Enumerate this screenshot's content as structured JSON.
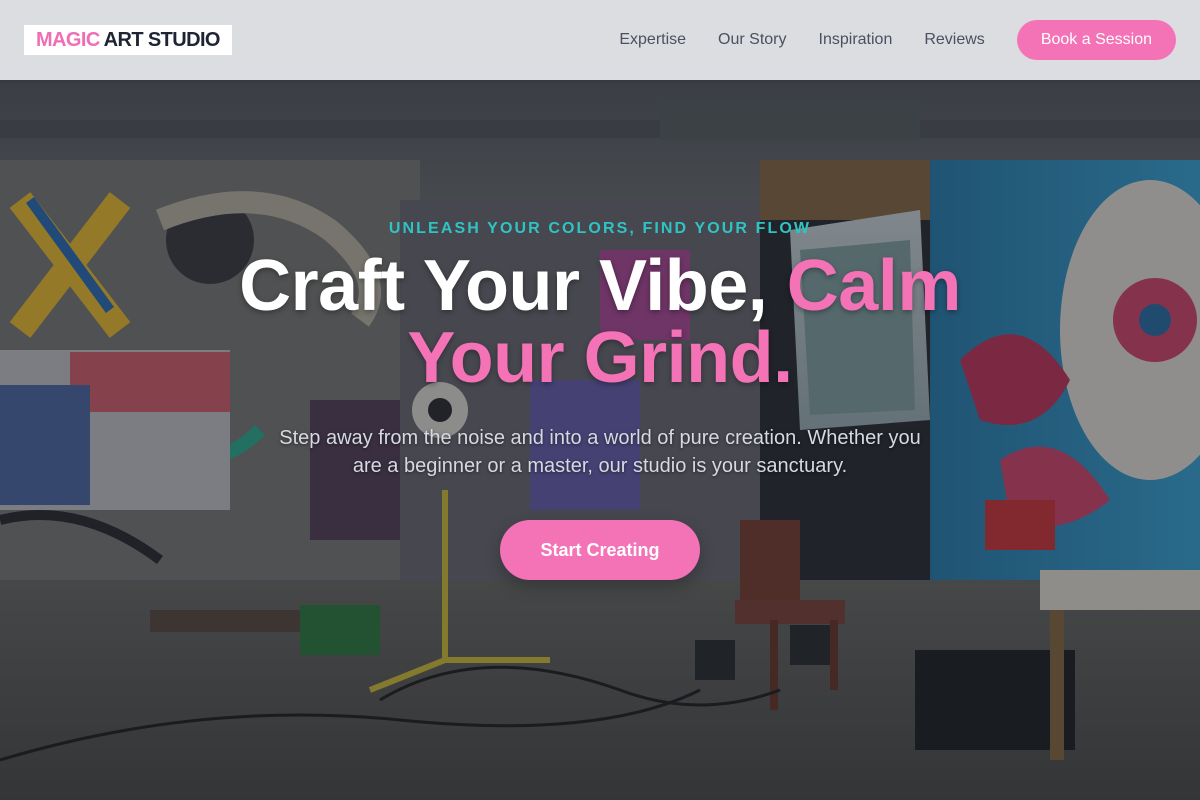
{
  "brand": {
    "logo_part1": "MAGIC",
    "logo_part2": "ART STUDIO"
  },
  "nav": {
    "links": [
      {
        "label": "Expertise"
      },
      {
        "label": "Our Story"
      },
      {
        "label": "Inspiration"
      },
      {
        "label": "Reviews"
      }
    ],
    "book_label": "Book a Session"
  },
  "hero": {
    "tagline": "UNLEASH YOUR COLORS, FIND YOUR FLOW",
    "headline_white": "Craft Your Vibe,",
    "headline_accent_1": "Calm",
    "headline_accent_2": "Your Grind.",
    "subtext": "Step away from the noise and into a world of pure creation. Whether you are a beginner or a master, our studio is your sanctuary.",
    "cta_label": "Start Creating",
    "background_icon": "graffiti-art-studio-photo"
  },
  "colors": {
    "accent_pink": "#f472b6",
    "accent_teal": "#2fc4c4",
    "text_dark": "#1e2433",
    "nav_text": "#4a5060"
  }
}
